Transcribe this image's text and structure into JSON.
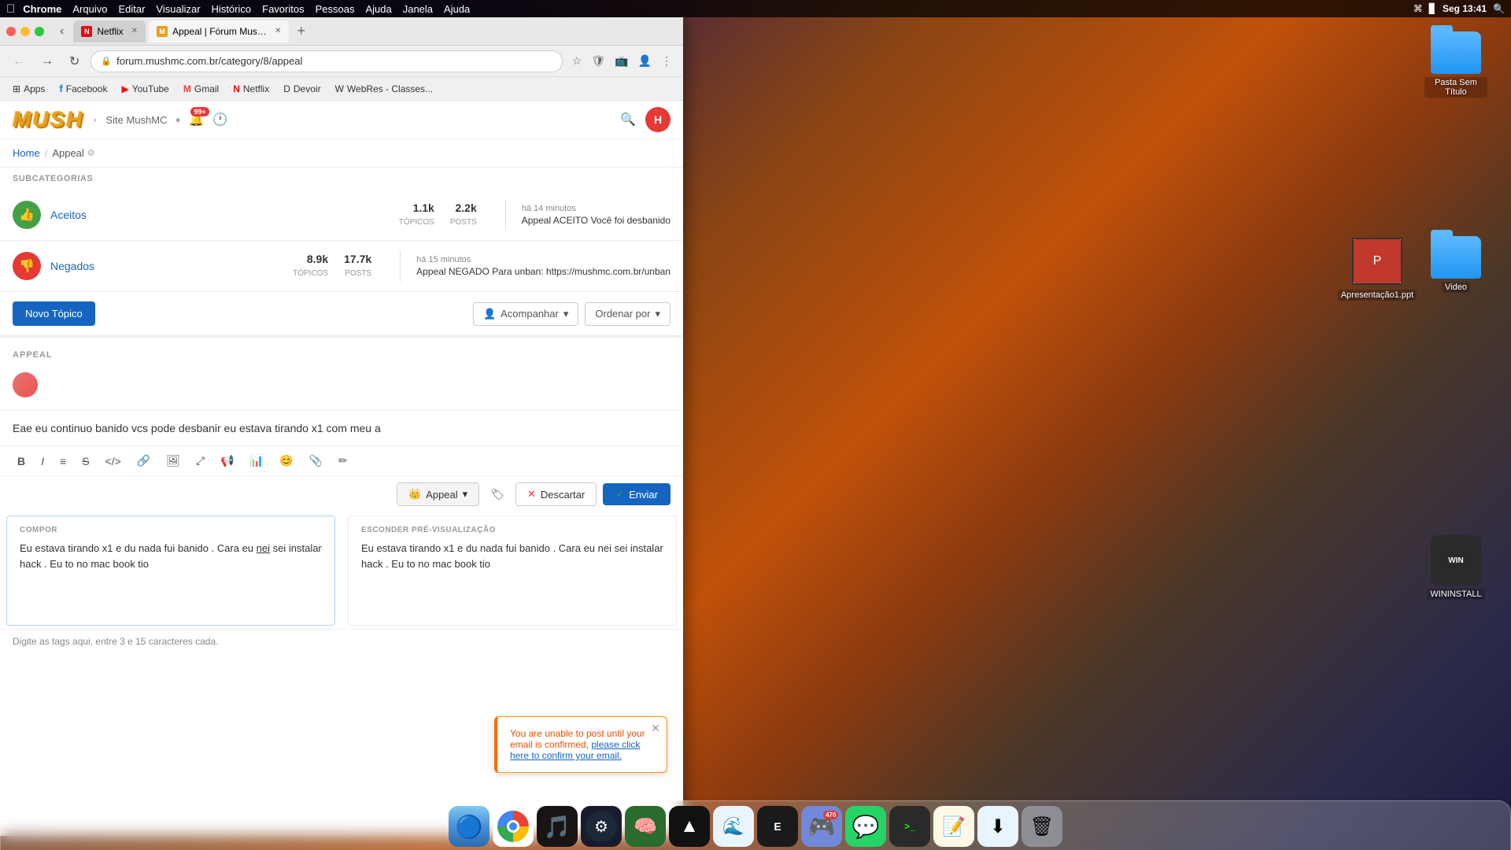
{
  "menubar": {
    "apple": "&#63743;",
    "app_name": "Chrome",
    "menus": [
      "Arquivo",
      "Editar",
      "Visualizar",
      "Histórico",
      "Favoritos",
      "Pessoas",
      "Ajuda",
      "Janela",
      "Ajuda"
    ],
    "time": "Seg 13:41"
  },
  "browser": {
    "tabs": [
      {
        "id": "tab1",
        "title": "Netflix",
        "favicon": "N",
        "active": false
      },
      {
        "id": "tab2",
        "title": "Appeal | Fórum MushMC",
        "favicon": "M",
        "active": true
      }
    ],
    "address": "forum.mushmc.com.br/category/8/appeal",
    "bookmarks": [
      {
        "label": "Apps",
        "icon": "⊞"
      },
      {
        "label": "Facebook",
        "icon": "f"
      },
      {
        "label": "YouTube",
        "icon": "▶"
      },
      {
        "label": "Gmail",
        "icon": "M"
      },
      {
        "label": "Netflix",
        "icon": "N"
      },
      {
        "label": "Devoir",
        "icon": "D"
      },
      {
        "label": "WebRes - Classes...",
        "icon": "W"
      }
    ]
  },
  "forum": {
    "logo": "MUSH",
    "site_label": "Site MushMC",
    "notification_count": "99+",
    "user_initial": "H",
    "breadcrumb": {
      "home": "Home",
      "current": "Appeal"
    },
    "subcategories_label": "SUBCATEGORIAS",
    "categories": [
      {
        "name": "Aceitos",
        "icon": "👍",
        "icon_class": "cat-icon-green",
        "topics": "1.1k",
        "posts": "2.2k",
        "last_time": "há 14 minutos",
        "last_title": "Appeal ACEITO Você foi desbanido"
      },
      {
        "name": "Negados",
        "icon": "👎",
        "icon_class": "cat-icon-red",
        "topics": "8.9k",
        "posts": "17.7k",
        "last_time": "há 15 minutos",
        "last_title": "Appeal NEGADO Para unban: https://mushmc.com.br/unban"
      }
    ],
    "toolbar": {
      "new_topic": "Novo Tópico",
      "follow": "Acompanhar",
      "order": "Ordenar por"
    },
    "appeal_label": "APPEAL",
    "compose": {
      "header_text": "Eae eu continuo banido vcs pode desbanir eu estava tirando x1 com meu a",
      "label_compose": "COMPOR",
      "label_preview": "ESCONDER PRÉ-VISUALIZAÇÃO",
      "body_text": "Eu estava tirando x1 e du nada fui banido . Cara eu nei sei instalar hack . Eu to no mac book tio",
      "body_text_underline": "nei",
      "btn_appeal": "Appeal",
      "btn_discard": "Descartar",
      "btn_send": "Enviar"
    },
    "alert": {
      "message": "You are unable to post until your email is confirmed, please click here to confirm your email."
    },
    "tags_hint": "Digite as tags aqui, entre 3 e 15 caracteres cada."
  },
  "desktop": {
    "folder1_label": "Pasta Sem Título",
    "folder2_label": "Video",
    "ppt_label": "Apresentação1.ppt",
    "wininstall_label": "WININSTALL"
  },
  "dock": {
    "discord_badge": "476",
    "items": [
      "Finder",
      "Chrome",
      "Spotify",
      "Steam",
      "MindNode",
      "TopNotch",
      "Mercury",
      "Epic Games",
      "Discord",
      "WhatsApp",
      "Exec",
      "Notes",
      "Downloads",
      "Trash"
    ]
  }
}
